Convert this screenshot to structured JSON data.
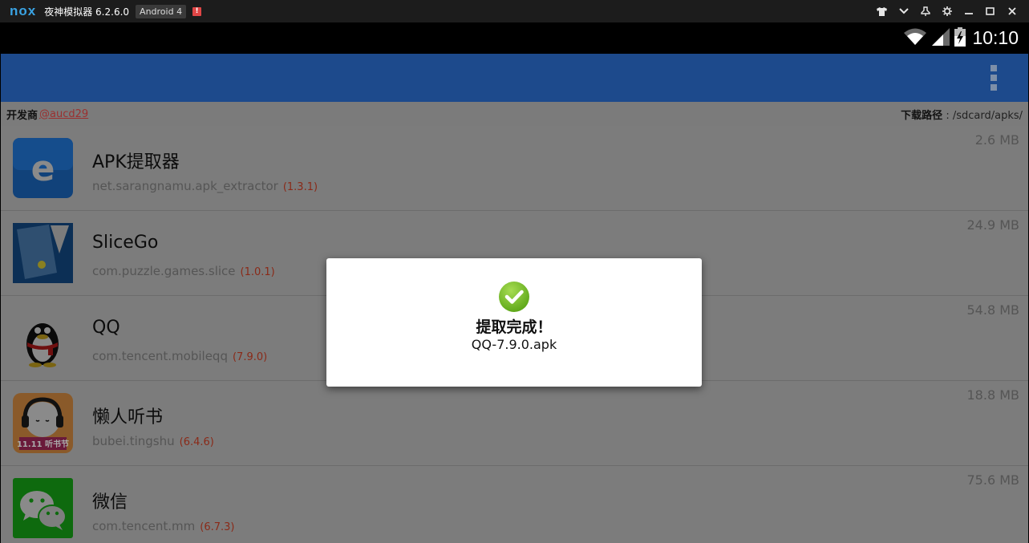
{
  "emulator": {
    "logo": "nox",
    "title": "夜神模拟器 6.2.6.0",
    "android_badge": "Android 4",
    "alert_badge": "!",
    "controls": [
      "shirt-icon",
      "chevron-down-icon",
      "pin-icon",
      "gear-icon",
      "minimize-icon",
      "maximize-icon",
      "close-icon"
    ]
  },
  "statusbar": {
    "time": "10:10"
  },
  "infobar": {
    "developer_label": "开发商",
    "developer_link": "@aucd29",
    "path_label": "下载路径",
    "path_value": " : /sdcard/apks/"
  },
  "apps": [
    {
      "name": "APK提取器",
      "package": "net.sarangnamu.apk_extractor",
      "version": "(1.3.1)",
      "size": "2.6 MB",
      "icon": "apk-extractor-icon"
    },
    {
      "name": "SliceGo",
      "package": "com.puzzle.games.slice",
      "version": "(1.0.1)",
      "size": "24.9 MB",
      "icon": "slicego-icon"
    },
    {
      "name": "QQ",
      "package": "com.tencent.mobileqq",
      "version": "(7.9.0)",
      "size": "54.8 MB",
      "icon": "qq-penguin-icon"
    },
    {
      "name": "懒人听书",
      "package": "bubei.tingshu",
      "version": "(6.4.6)",
      "size": "18.8 MB",
      "icon": "lazy-audiobook-icon",
      "icon_badge": "11.11 听书节"
    },
    {
      "name": "微信",
      "package": "com.tencent.mm",
      "version": "(6.7.3)",
      "size": "75.6 MB",
      "icon": "wechat-icon"
    }
  ],
  "dialog": {
    "title": "提取完成！",
    "filename": "QQ-7.9.0.apk",
    "icon": "check-circle-icon"
  },
  "colors": {
    "appbar": "#1d4a8c",
    "dialog_check": "#7cc12a",
    "version_text": "#8a2a18"
  }
}
